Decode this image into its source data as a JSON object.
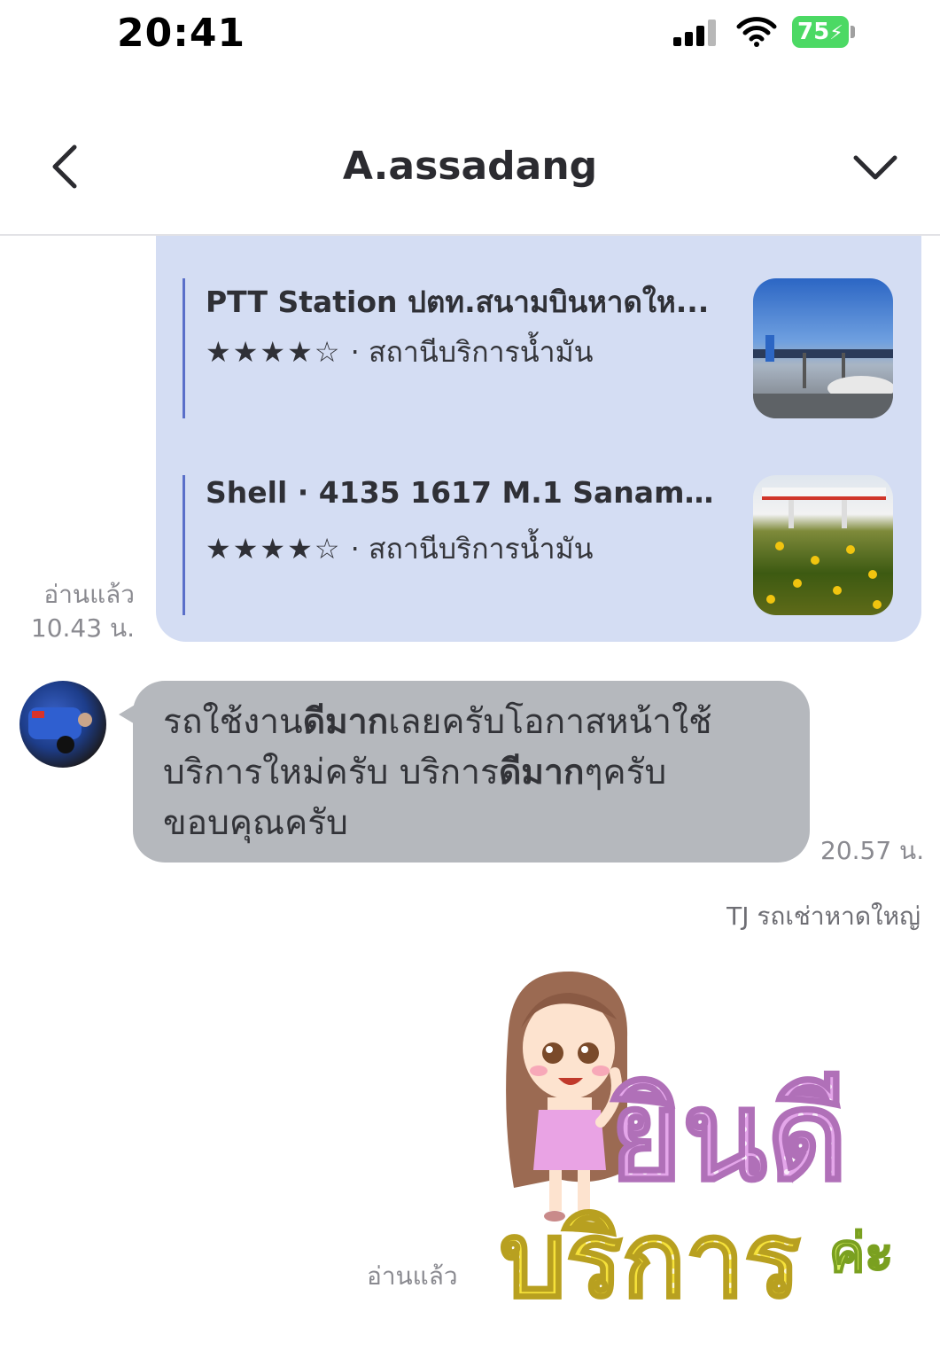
{
  "status_bar": {
    "time": "20:41",
    "battery": "75"
  },
  "header": {
    "title": "A.assadang"
  },
  "location_card": {
    "items": [
      {
        "name": "PTT Station ปตท.สนามบินหาดให...",
        "stars": "★★★★☆",
        "category": " · สถานีบริการน้ำมัน"
      },
      {
        "name": "Shell · 4135 1617 M.1 Sanambin...",
        "stars": "★★★★☆",
        "category": " · สถานีบริการน้ำมัน"
      }
    ],
    "read_status": "อ่านแล้ว",
    "time": "10.43 น."
  },
  "received_message": {
    "segments": [
      "รถใช้งาน",
      "ดีมาก",
      "เลยครับโอกาสหน้าใช้",
      "บริการใหม่ครับ บริการ",
      "ดีมาก",
      "ๆครับ",
      "ขอบคุณครับ"
    ],
    "time": "20.57 น."
  },
  "sender_label": "TJ รถเช่าหาดใหญ่",
  "sticker": {
    "line1": "ยินดี",
    "line2": "บริการ",
    "line3": "ค่ะ",
    "read_status": "อ่านแล้ว"
  },
  "colors": {
    "sent_card_bg": "#d4ddf3",
    "received_bubble_bg": "#b5b8bd",
    "battery_green": "#4cd964",
    "accent_bar": "#5a6fc9"
  }
}
